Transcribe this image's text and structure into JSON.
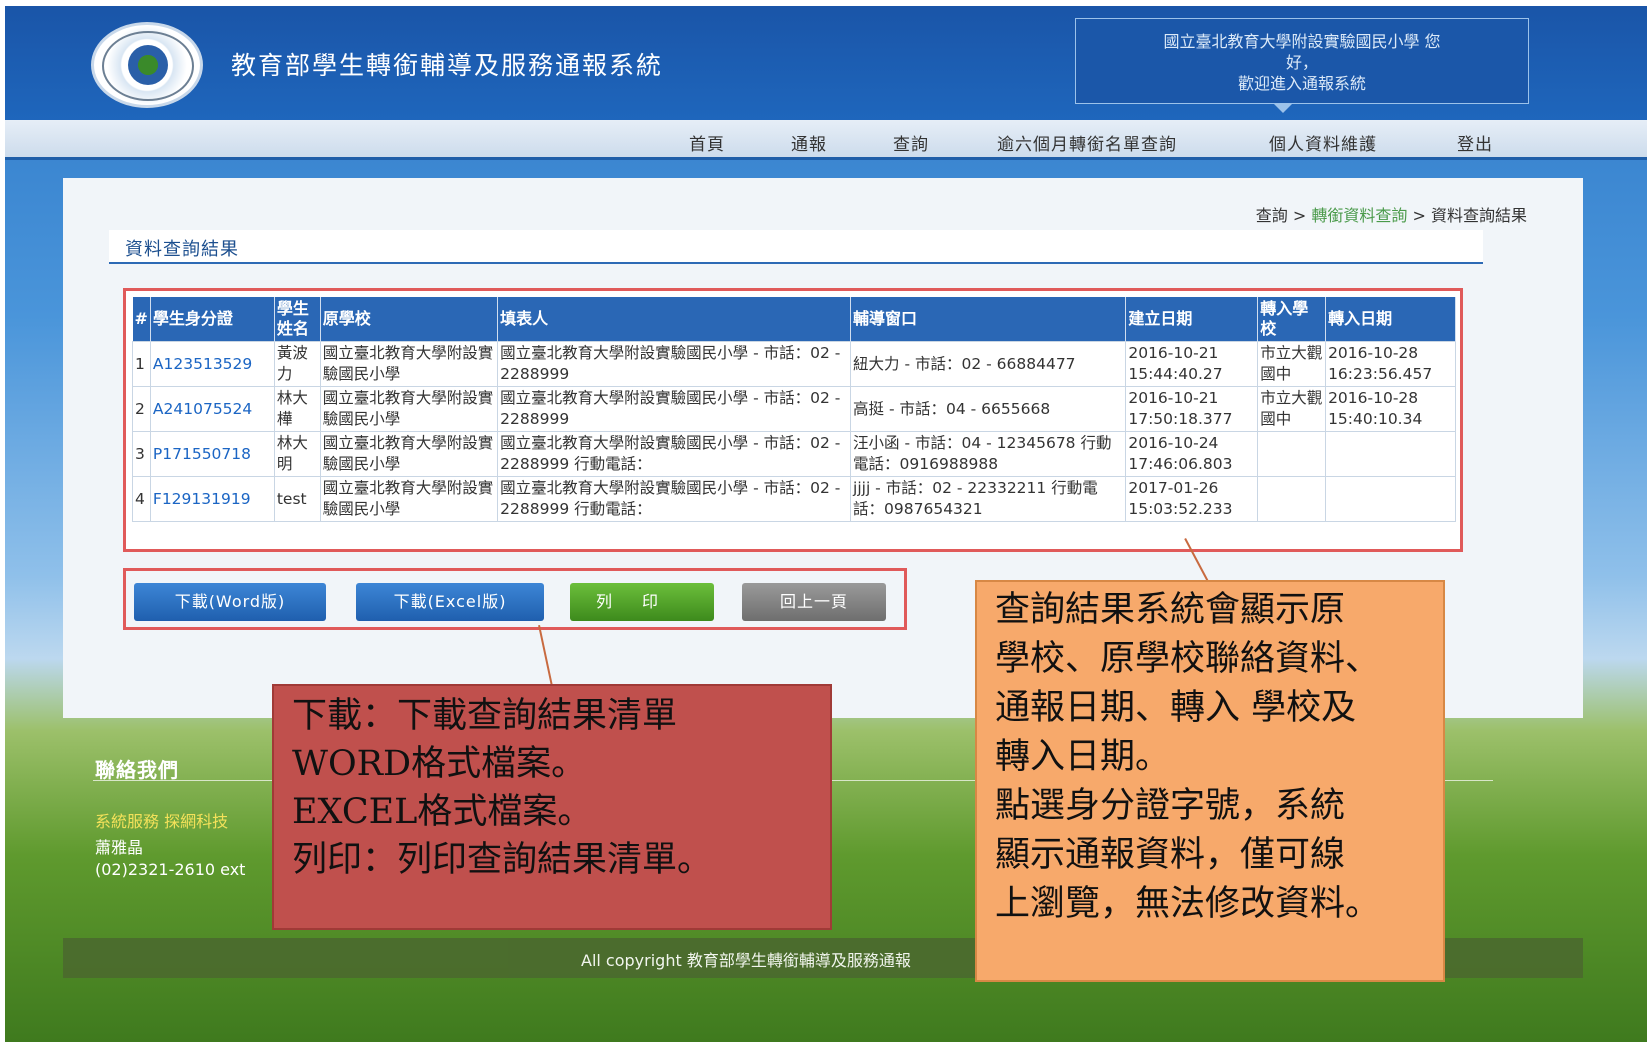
{
  "header": {
    "site_title": "教育部學生轉銜輔導及服務通報系統",
    "welcome_line1": "國立臺北教育大學附設實驗國民小學 您",
    "welcome_line2": "好，",
    "welcome_line3": "歡迎進入通報系統"
  },
  "nav": {
    "items": [
      "首頁",
      "通報",
      "查詢",
      "逾六個月轉銜名單查詢",
      "個人資料維護",
      "登出"
    ]
  },
  "breadcrumb": {
    "root": "查詢",
    "sep": " > ",
    "link": "轉銜資料查詢",
    "current": "資料查詢結果"
  },
  "section_title": "資料查詢結果",
  "table": {
    "headers": [
      "#",
      "學生身分證",
      "學生姓名",
      "原學校",
      "填表人",
      "輔導窗口",
      "建立日期",
      "轉入學校",
      "轉入日期"
    ],
    "rows": [
      [
        "1",
        "A123513529",
        "黃波力",
        "國立臺北教育大學附設實驗國民小學",
        "國立臺北教育大學附設實驗國民小學 - 市話：02 - 2288999",
        "紐大力 - 市話：02 - 66884477",
        "2016-10-21 15:44:40.27",
        "市立大觀國中",
        "2016-10-28 16:23:56.457"
      ],
      [
        "2",
        "A241075524",
        "林大樺",
        "國立臺北教育大學附設實驗國民小學",
        "國立臺北教育大學附設實驗國民小學 - 市話：02 - 2288999",
        "高挺 - 市話：04 - 6655668",
        "2016-10-21 17:50:18.377",
        "市立大觀國中",
        "2016-10-28 15:40:10.34"
      ],
      [
        "3",
        "P171550718",
        "林大明",
        "國立臺北教育大學附設實驗國民小學",
        "國立臺北教育大學附設實驗國民小學 - 市話：02 - 2288999 行動電話：",
        "汪小函 - 市話：04 - 12345678 行動電話：0916988988",
        "2016-10-24 17:46:06.803",
        "",
        ""
      ],
      [
        "4",
        "F129131919",
        "test",
        "國立臺北教育大學附設實驗國民小學",
        "國立臺北教育大學附設實驗國民小學 - 市話：02 - 2288999 行動電話：",
        "jjjj - 市話：02 - 22332211 行動電話：0987654321",
        "2017-01-26 15:03:52.233",
        "",
        ""
      ]
    ]
  },
  "buttons": {
    "word": "下載(Word版)",
    "excel": "下載(Excel版)",
    "print": "列印",
    "back": "回上一頁"
  },
  "footer": {
    "title": "聯絡我們",
    "service": "系統服務 探網科技",
    "person": "蕭雅晶",
    "phone": "(02)2321-2610 ext",
    "copyright": "All copyright 教育部學生轉銜輔導及服務通報"
  },
  "callout_red": {
    "line1": "下載：下載查詢結果清單",
    "line2": "WORD格式檔案。",
    "line3": "EXCEL格式檔案。",
    "line4": "列印：列印查詢結果清單。"
  },
  "callout_orange": {
    "line1": "查詢結果系統會顯示原",
    "line2": "學校、原學校聯絡資料、",
    "line3": "通報日期、轉入 學校及",
    "line4": "轉入日期。",
    "line5": "點選身分證字號，系統",
    "line6": "顯示通報資料，僅可線",
    "line7": "上瀏覽，無法修改資料。"
  },
  "colors": {
    "header_blue": "#1f67bd",
    "table_header": "#2a67b5",
    "link_blue": "#1b65c4",
    "breadcrumb_green": "#4a9a4a",
    "callout_red": "#c0504d",
    "callout_orange": "#f7a96b",
    "highlight_border": "#e05a5a"
  }
}
